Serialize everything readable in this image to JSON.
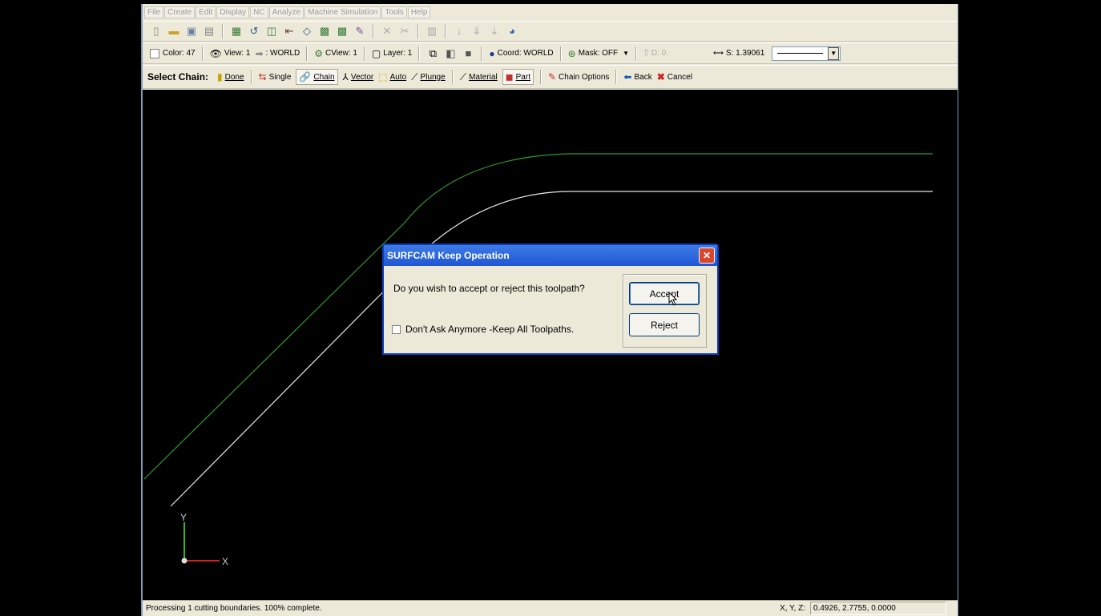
{
  "menu": [
    "File",
    "Create",
    "Edit",
    "Display",
    "NC",
    "Analyze",
    "Machine Simulation",
    "Tools",
    "Help"
  ],
  "toolbar1_icons": [
    "new-file-icon",
    "open-folder-icon",
    "save-icon",
    "print-icon",
    "nc-op-icon",
    "toolpath-icon",
    "copy-op-icon",
    "edit-op-icon",
    "shape-icon",
    "group-icon",
    "group2-icon",
    "pen-icon",
    "delete-icon",
    "trim-icon",
    "grid-icon",
    "arrow-down-icon",
    "arrow-down2-icon",
    "move-icon",
    "part-icon"
  ],
  "toolbar2": {
    "color": "Color: 47",
    "view": "View: 1",
    "world": ": WORLD",
    "cview": "CView: 1",
    "layer": "Layer: 1",
    "coord": "Coord: WORLD",
    "mask": "Mask: OFF",
    "depth": "D: 0.",
    "spacing": "S: 1.39061"
  },
  "toolbar3": {
    "label": "Select Chain:",
    "done": "Done",
    "single": "Single",
    "chain": "Chain",
    "vector": "Vector",
    "auto": "Auto",
    "plunge": "Plunge",
    "material": "Material",
    "part": "Part",
    "chain_options": "Chain Options",
    "back": "Back",
    "cancel": "Cancel"
  },
  "dialog": {
    "title": "SURFCAM Keep Operation",
    "question": "Do you wish to accept or reject this toolpath?",
    "checkbox_label": "Don't Ask Anymore -Keep All Toolpaths.",
    "accept": "Accept",
    "reject": "Reject"
  },
  "axes": {
    "y": "Y",
    "x": "X"
  },
  "status": {
    "message": "Processing 1 cutting boundaries. 100% complete.",
    "xyz_label": "X, Y, Z:",
    "xyz_value": "0.4926, 2.7755, 0.0000"
  },
  "colors": {
    "outer_curve": "#2e9a2e",
    "inner_curve": "#e6e6e6",
    "title_bar": "#2a62d9"
  }
}
